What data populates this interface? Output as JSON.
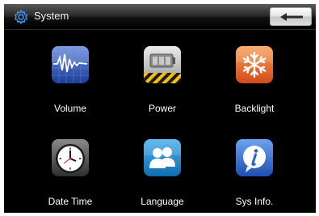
{
  "header": {
    "title": "System",
    "title_icon": "gear-icon",
    "back_icon": "back-arrow-icon"
  },
  "menu": {
    "items": [
      {
        "label": "Volume",
        "icon": "volume-icon"
      },
      {
        "label": "Power",
        "icon": "battery-icon"
      },
      {
        "label": "Backlight",
        "icon": "snowflake-icon"
      },
      {
        "label": "Date Time",
        "icon": "clock-icon"
      },
      {
        "label": "Language",
        "icon": "people-icon"
      },
      {
        "label": "Sys Info.",
        "icon": "info-icon"
      }
    ]
  },
  "colors": {
    "background": "#000000",
    "text": "#ffffff",
    "volume_blue": "#2f57b8",
    "backlight_orange": "#e2642a",
    "language_blue": "#1a86c9",
    "info_blue": "#2a62c9"
  }
}
